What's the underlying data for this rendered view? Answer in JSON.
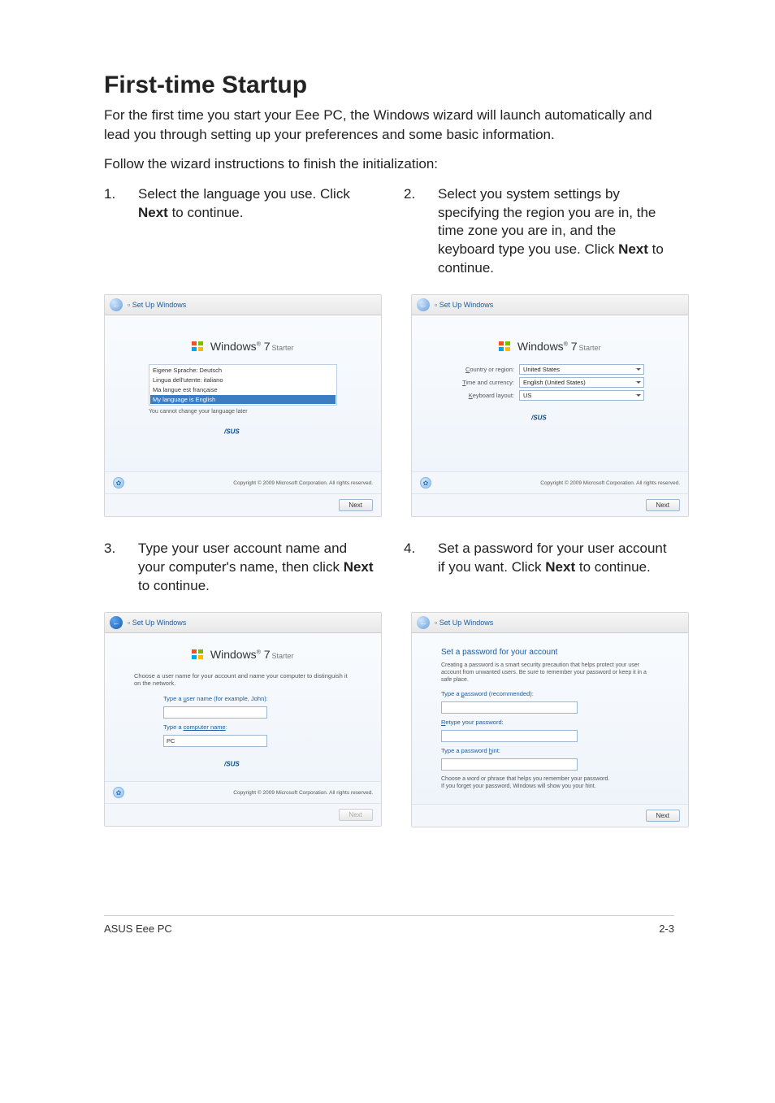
{
  "page": {
    "title": "First-time Startup",
    "intro": "For the first time you start your Eee PC, the Windows wizard will launch automatically and lead you through setting up your preferences and some basic information.",
    "lead": "Follow the wizard instructions to finish the initialization:",
    "footer_left": "ASUS Eee PC",
    "footer_right": "2-3"
  },
  "steps": [
    {
      "num": "1.",
      "text": "Select the language you use. Click ",
      "bold": "Next",
      "after": " to continue."
    },
    {
      "num": "2.",
      "text": "Select you system settings by specifying the region you are in, the time zone you are in, and the keyboard type you use. Click ",
      "bold": "Next",
      "after": " to continue."
    },
    {
      "num": "3.",
      "text": "Type your user account name and your computer's name, then click ",
      "bold": "Next",
      "after": " to continue."
    },
    {
      "num": "4.",
      "text": "Set a password for your user account if you want. Click ",
      "bold": "Next",
      "after": " to continue."
    }
  ],
  "wizard_common": {
    "window_title": "Set Up Windows",
    "brand_main": "Windows",
    "brand_ver": "7",
    "brand_edition": "Starter",
    "copyright": "Copyright © 2009 Microsoft Corporation. All rights reserved.",
    "next": "Next"
  },
  "wiz1": {
    "languages": [
      "Eigene Sprache: Deutsch",
      "Lingua dell'utente: italiano",
      "Ma langue est française",
      "My language is English"
    ],
    "selected_index": 3,
    "note": "You cannot change your language later"
  },
  "wiz2": {
    "rows": [
      {
        "label_u": "C",
        "label_rest": "ountry or region:",
        "value": "United States"
      },
      {
        "label_u": "T",
        "label_rest": "ime and currency:",
        "value": "English (United States)"
      },
      {
        "label_u": "K",
        "label_rest": "eyboard layout:",
        "value": "US"
      }
    ]
  },
  "wiz3": {
    "subtitle_a": "Choose a user name for your ",
    "subtitle_link": "account",
    "subtitle_b": " and name your computer to distinguish it on the network.",
    "field1_label_a": "Type a ",
    "field1_label_u": "u",
    "field1_label_b": "ser name (for example, John):",
    "field2_label_a": "Type a ",
    "field2_link": "computer name",
    "field2_label_b": ":",
    "computer_name": "PC"
  },
  "wiz4": {
    "heading": "Set a password for your account",
    "desc": "Creating a password is a smart security precaution that helps protect your user account from unwanted users. Be sure to remember your password or keep it in a safe place.",
    "f1_a": "Type a ",
    "f1_u": "p",
    "f1_b": "assword (recommended):",
    "f2_u": "R",
    "f2_b": "etype your password:",
    "f3_a": "Type a password ",
    "f3_u": "h",
    "f3_b": "int:",
    "hint_note1": "Choose a word or phrase that helps you remember your password.",
    "hint_note2": "If you forget your password, Windows will show you your hint."
  }
}
